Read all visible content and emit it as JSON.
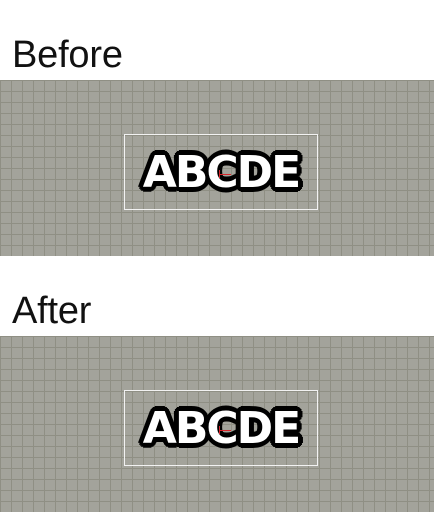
{
  "sections": {
    "before": {
      "heading": "Before",
      "text": "ABCDE"
    },
    "after": {
      "heading": "After",
      "text": "ABCDE"
    }
  },
  "colors": {
    "canvas_background": "#a3a39b",
    "grid_lines": "#8f8f84",
    "text_fill": "#ffffff",
    "text_stroke": "#000000",
    "selection_box": "#f2f2f2",
    "origin_marker": "#d8262b"
  }
}
